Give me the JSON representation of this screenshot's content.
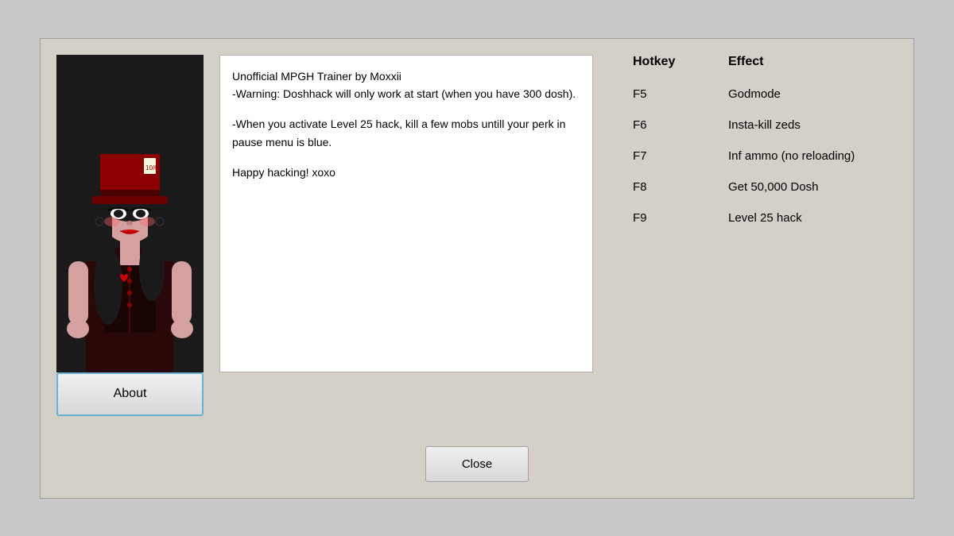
{
  "dialog": {
    "description_lines": [
      "Unofficial MPGH Trainer by Moxxii",
      "-Warning: Doshhack will only work at start (when you have 300 dosh).",
      "-When you activate Level 25 hack, kill a few mobs untill your perk in pause menu is blue.",
      "Happy hacking! xoxo"
    ],
    "about_button_label": "About",
    "close_button_label": "Close",
    "hotkey_table": {
      "header_hotkey": "Hotkey",
      "header_effect": "Effect",
      "rows": [
        {
          "key": "F5",
          "effect": "Godmode"
        },
        {
          "key": "F6",
          "effect": "Insta-kill zeds"
        },
        {
          "key": "F7",
          "effect": "Inf ammo (no reloading)"
        },
        {
          "key": "F8",
          "effect": "Get 50,000 Dosh"
        },
        {
          "key": "F9",
          "effect": "Level 25 hack"
        }
      ]
    }
  }
}
